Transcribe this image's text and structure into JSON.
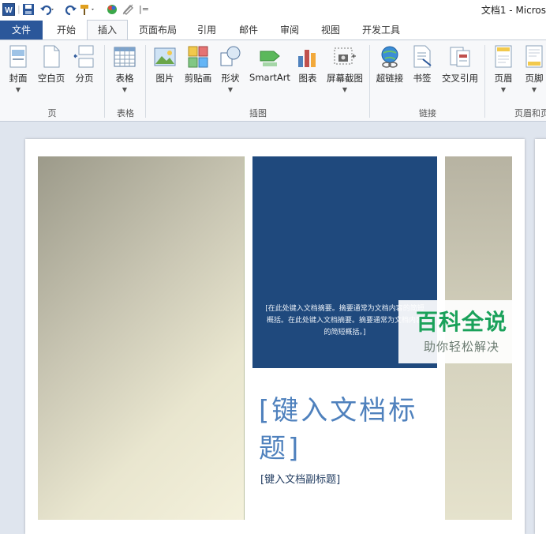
{
  "window": {
    "title": "文档1 - Micros"
  },
  "quick_access": {
    "word_icon_label": "W",
    "customize_glyph": "|="
  },
  "tabs": [
    {
      "label": "文件"
    },
    {
      "label": "开始"
    },
    {
      "label": "插入"
    },
    {
      "label": "页面布局"
    },
    {
      "label": "引用"
    },
    {
      "label": "邮件"
    },
    {
      "label": "审阅"
    },
    {
      "label": "视图"
    },
    {
      "label": "开发工具"
    }
  ],
  "ribbon": {
    "groups": [
      {
        "label": "页"
      },
      {
        "label": "表格"
      },
      {
        "label": "插图"
      },
      {
        "label": "链接"
      },
      {
        "label": "页眉和页"
      }
    ],
    "buttons": [
      {
        "label": "封面",
        "icon": "cover-page-icon"
      },
      {
        "label": "空白页",
        "icon": "blank-page-icon"
      },
      {
        "label": "分页",
        "icon": "page-break-icon"
      },
      {
        "label": "表格",
        "icon": "table-icon"
      },
      {
        "label": "图片",
        "icon": "picture-icon"
      },
      {
        "label": "剪贴画",
        "icon": "clip-art-icon"
      },
      {
        "label": "形状",
        "icon": "shapes-icon"
      },
      {
        "label": "SmartArt",
        "icon": "smartart-icon"
      },
      {
        "label": "图表",
        "icon": "chart-icon"
      },
      {
        "label": "屏幕截图",
        "icon": "screenshot-icon"
      },
      {
        "label": "超链接",
        "icon": "hyperlink-icon"
      },
      {
        "label": "书签",
        "icon": "bookmark-icon"
      },
      {
        "label": "交叉引用",
        "icon": "cross-reference-icon"
      },
      {
        "label": "页眉",
        "icon": "header-icon"
      },
      {
        "label": "页脚",
        "icon": "footer-icon"
      }
    ]
  },
  "document": {
    "abstract": "[在此处键入文档摘要。摘要通常为文档内容的简短概括。在此处键入文档摘要。摘要通常为文档内容的简短概括。]",
    "title_placeholder": "[键入文档标题]",
    "subtitle_placeholder": "[键入文档副标题]"
  },
  "watermark": {
    "title": "百科全说",
    "subtitle": "助你轻松解决"
  },
  "colors": {
    "file_tab": "#2b579a",
    "abstract_box": "#1f497d",
    "title_text": "#4f81bd",
    "watermark_green": "#1aa15a"
  }
}
